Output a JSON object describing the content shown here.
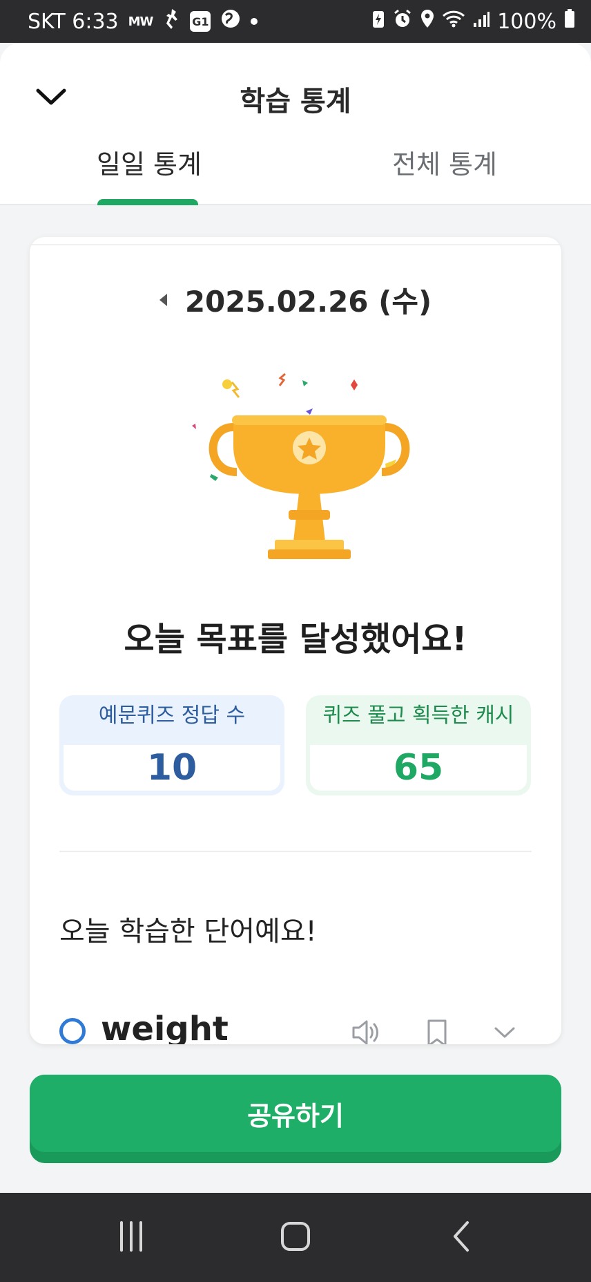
{
  "status_bar": {
    "carrier_time": "SKT 6:33",
    "mini_text": "MW",
    "app_badge": "G1",
    "battery": "100%"
  },
  "header": {
    "title": "학습 통계",
    "tabs": [
      {
        "label": "일일 통계",
        "active": true
      },
      {
        "label": "전체 통계",
        "active": false
      }
    ]
  },
  "daily": {
    "date": "2025.02.26 (수)",
    "achievement": "오늘 목표를 달성했어요!",
    "stats": [
      {
        "label": "예문퀴즈 정답 수",
        "value": "10",
        "color": "#2d5d9e"
      },
      {
        "label": "퀴즈 풀고 획득한 캐시",
        "value": "65",
        "color": "#1fa864"
      }
    ],
    "section_title": "오늘 학습한 단어예요!",
    "words": [
      {
        "word": "weight"
      }
    ]
  },
  "actions": {
    "share_label": "공유하기"
  },
  "colors": {
    "accent": "#1fae67",
    "blue": "#2f7ad6"
  }
}
